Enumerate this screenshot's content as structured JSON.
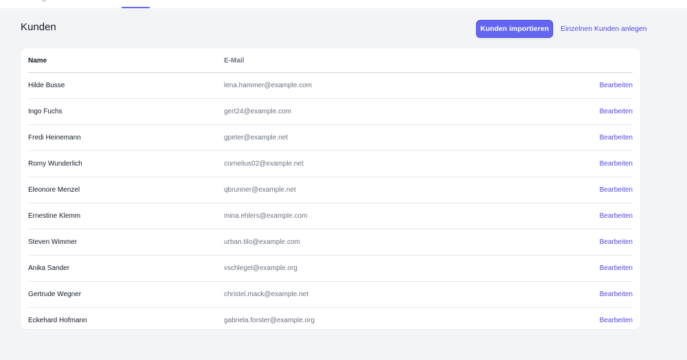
{
  "page": {
    "title": "Kunden",
    "import_button_label": "Kunden importieren",
    "create_single_link_label": "Einzelnen Kunden anlegen"
  },
  "table": {
    "columns": [
      "Name",
      "E-Mail",
      ""
    ],
    "rows": [
      {
        "name": "Hilde Busse",
        "email": "lena.hammer@example.com",
        "action": "Bearbeiten"
      },
      {
        "name": "Ingo Fuchs",
        "email": "gert24@example.com",
        "action": "Bearbeiten"
      },
      {
        "name": "Fredi Heinemann",
        "email": "gpeter@example.net",
        "action": "Bearbeiten"
      },
      {
        "name": "Romy Wunderlich",
        "email": "cornelius02@example.net",
        "action": "Bearbeiten"
      },
      {
        "name": "Eleonore Menzel",
        "email": "qbrunner@example.net",
        "action": "Bearbeiten"
      },
      {
        "name": "Ernestine Klemm",
        "email": "mina.ehlers@example.com",
        "action": "Bearbeiten"
      },
      {
        "name": "Steven Wimmer",
        "email": "urban.tilo@example.com",
        "action": "Bearbeiten"
      },
      {
        "name": "Anika Sander",
        "email": "vschlegel@example.org",
        "action": "Bearbeiten"
      },
      {
        "name": "Gertrude Wegner",
        "email": "christel.mack@example.net",
        "action": "Bearbeiten"
      },
      {
        "name": "Eckehard Hofmann",
        "email": "gabriela.forster@example.org",
        "action": "Bearbeiten"
      }
    ]
  },
  "colors": {
    "accent": "#6366f1",
    "link": "#4f46e5",
    "background": "#f3f4f6",
    "card": "#ffffff"
  }
}
